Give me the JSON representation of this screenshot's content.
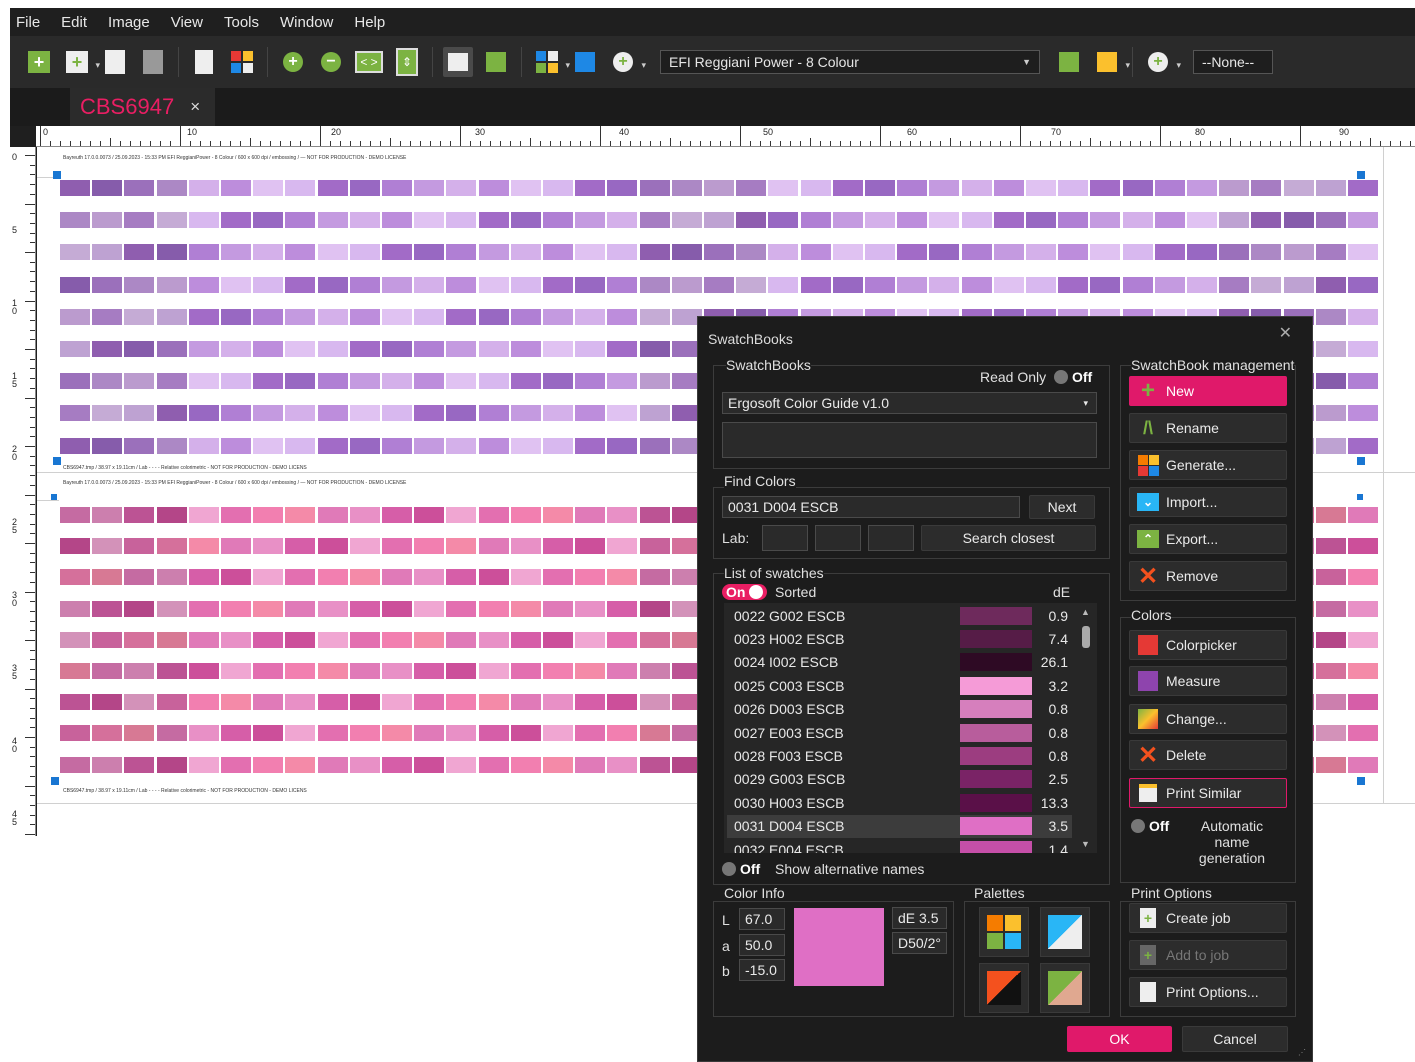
{
  "menu": [
    "File",
    "Edit",
    "Image",
    "View",
    "Tools",
    "Window",
    "Help"
  ],
  "toolbar": {
    "printer_profile": "EFI Reggiani Power - 8 Colour",
    "layer_select": "--None--"
  },
  "tabs": [
    {
      "label": "CBS6947",
      "close": "×"
    }
  ],
  "ruler": {
    "h_labels": [
      "0",
      "10",
      "20",
      "30",
      "40",
      "50",
      "60",
      "70",
      "80",
      "90"
    ],
    "v_labels": [
      "0",
      "5",
      "1\n0",
      "1\n5",
      "2\n0",
      "2\n5",
      "3\n0",
      "3\n5",
      "4\n0",
      "4\n5"
    ]
  },
  "canvas": {
    "sheet1_header": "Bayreuth 17.0.0.0073 / 25.09.2023 - 15:33 PM  EFI ReggianiPower - 8 Colour / 600 x 600 dpi / embossing / — NOT FOR PRODUCTION - DEMO LICENSE",
    "sheet1_footer": "CBS6947.tmp / 38.97 x 19.11cm / Lab - - - - Relative colorimetric - NOT FOR PRODUCTION - DEMO LICENS",
    "sheet2_header": "Bayreuth 17.0.0.0073 / 25.09.2023 - 15:33 PM  EFI ReggianiPower - 8 Colour / 600 x 600 dpi / embossing / — NOT FOR PRODUCTION - DEMO LICENSE",
    "sheet2_footer": "CBS6947.tmp / 38.97 x 19.11cm / Lab - - - - Relative colorimetric - NOT FOR PRODUCTION - DEMO LICENS",
    "purple_palette": [
      "#a26bc7",
      "#9868c2",
      "#b07fd4",
      "#c49ae0",
      "#d4b0ea",
      "#bd8ddc",
      "#e0c2f2",
      "#d8b8ef"
    ],
    "pink_palette": [
      "#e07ab8",
      "#e890c6",
      "#d65ea8",
      "#cc4f9a",
      "#f0a6d2",
      "#e36fb0",
      "#f27fb0",
      "#f48aa8"
    ]
  },
  "dialog": {
    "title": "SwatchBooks",
    "close": "✕",
    "swatchbooks": {
      "label": "SwatchBooks",
      "read_only_label": "Read Only",
      "read_only_state": "Off",
      "selected": "Ergosoft Color Guide v1.0",
      "description": ""
    },
    "find": {
      "label": "Find Colors",
      "query": "0031 D004 ESCB",
      "next": "Next",
      "lab_label": "Lab:",
      "lab_L": "",
      "lab_a": "",
      "lab_b": "",
      "search_closest": "Search closest"
    },
    "list": {
      "label": "List of swatches",
      "sorted_state": "On",
      "sorted_label": "Sorted",
      "de_header": "dE",
      "rows": [
        {
          "name": "0022 G002 ESCB",
          "color": "#6e2a5c",
          "de": "0.9"
        },
        {
          "name": "0023 H002 ESCB",
          "color": "#561c47",
          "de": "7.4"
        },
        {
          "name": "0024 I002 ESCB",
          "color": "#2e0a24",
          "de": "26.1"
        },
        {
          "name": "0025 C003 ESCB",
          "color": "#f59bd7",
          "de": "3.2"
        },
        {
          "name": "0026 D003 ESCB",
          "color": "#d67fbd",
          "de": "0.8"
        },
        {
          "name": "0027 E003 ESCB",
          "color": "#b85d9c",
          "de": "0.8"
        },
        {
          "name": "0028 F003 ESCB",
          "color": "#9c3d80",
          "de": "0.8"
        },
        {
          "name": "0029 G003 ESCB",
          "color": "#7a2366",
          "de": "2.5"
        },
        {
          "name": "0030 H003 ESCB",
          "color": "#5a1048",
          "de": "13.3"
        },
        {
          "name": "0031 D004 ESCB",
          "color": "#df6fc5",
          "de": "3.5"
        },
        {
          "name": "0032 E004 ESCB",
          "color": "#c54fa8",
          "de": "1.4"
        }
      ],
      "alt_names_state": "Off",
      "alt_names_label": "Show alternative names"
    },
    "management": {
      "label": "SwatchBook management",
      "new": "New",
      "rename": "Rename",
      "generate": "Generate...",
      "import": "Import...",
      "export": "Export...",
      "remove": "Remove"
    },
    "colors": {
      "label": "Colors",
      "colorpicker": "Colorpicker",
      "measure": "Measure",
      "change": "Change...",
      "delete": "Delete",
      "print_similar": "Print Similar",
      "auto_name_state": "Off",
      "auto_name_label": "Automatic name generation"
    },
    "color_info": {
      "label": "Color Info",
      "L_label": "L",
      "L": "67.0",
      "a_label": "a",
      "a": "50.0",
      "b_label": "b",
      "b": "-15.0",
      "swatch": "#df6fc5",
      "de": "dE 3.5",
      "illuminant": "D50/2°"
    },
    "palettes": {
      "label": "Palettes"
    },
    "print_options": {
      "label": "Print Options",
      "create_job": "Create job",
      "add_to_job": "Add to job",
      "print_options": "Print Options..."
    },
    "ok": "OK",
    "cancel": "Cancel"
  }
}
